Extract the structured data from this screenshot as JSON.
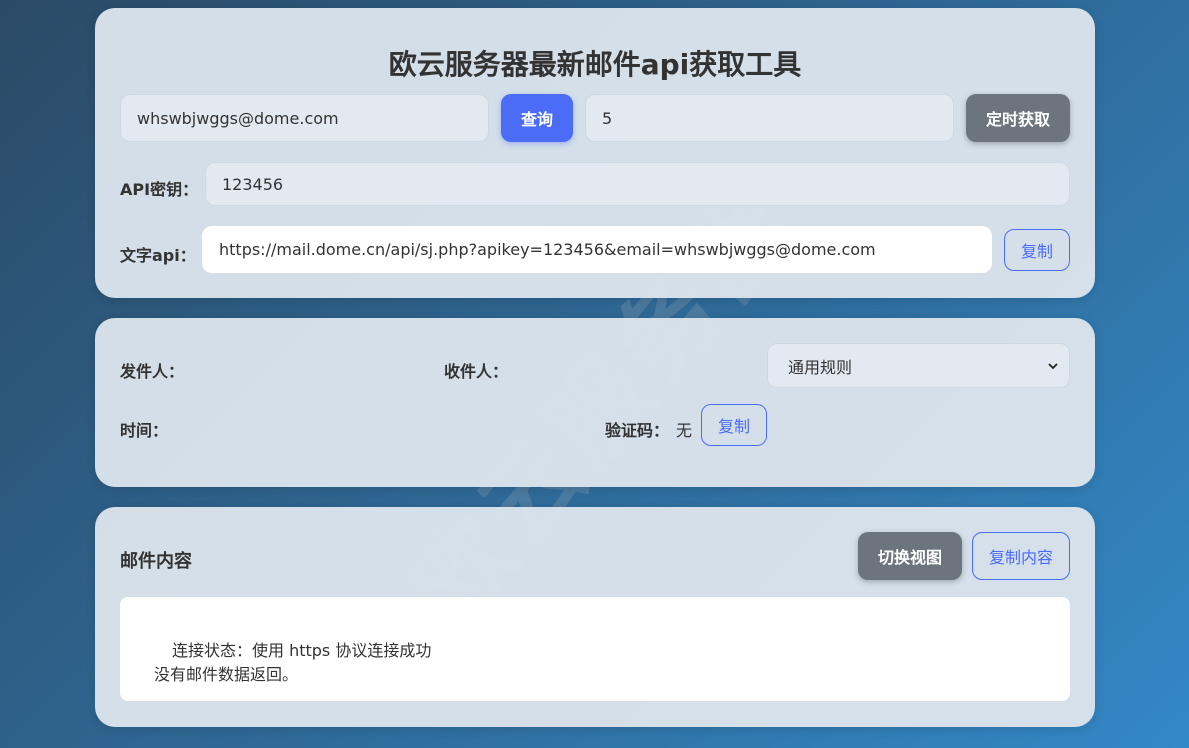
{
  "header": {
    "title": "欧云服务器最新邮件api获取工具"
  },
  "query": {
    "email_value": "whswbjwggs@dome.com",
    "query_button": "查询",
    "interval_value": "5",
    "timer_button": "定时获取"
  },
  "api_key": {
    "label": "API密钥：",
    "value": "123456"
  },
  "text_api": {
    "label": "文字api：",
    "url": "https://mail.dome.cn/api/sj.php?apikey=123456&email=whswbjwggs@dome.com",
    "copy_button": "复制"
  },
  "mail_info": {
    "sender_label": "发件人：",
    "recipient_label": "收件人：",
    "rule_select_value": "通用规则",
    "time_label": "时间：",
    "code_label": "验证码：",
    "code_value": "无",
    "copy_button": "复制"
  },
  "mail_content": {
    "title": "邮件内容",
    "switch_view_button": "切换视图",
    "copy_content_button": "复制内容",
    "line1": "连接状态：使用 https 协议连接成功",
    "line2": "没有邮件数据返回。"
  },
  "watermark": {
    "text": "欧云服务器"
  },
  "colors": {
    "primary": "#4a6cf7",
    "gray_button": "#6c757d"
  }
}
